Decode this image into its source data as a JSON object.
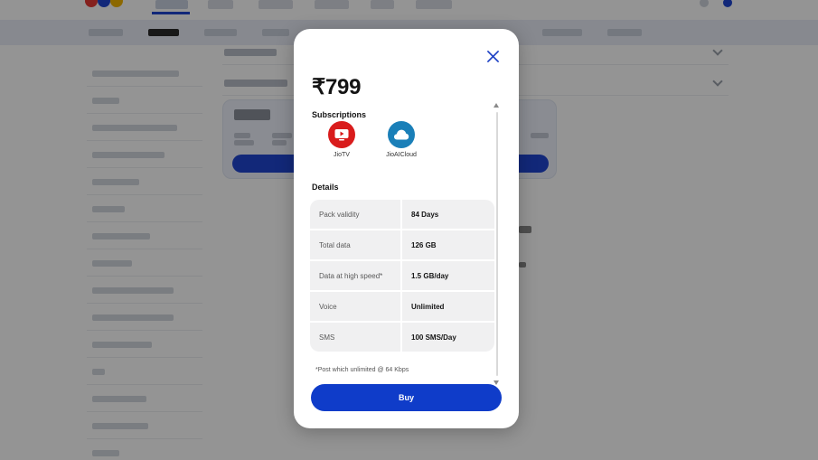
{
  "modal": {
    "price": "₹799",
    "subscriptions_title": "Subscriptions",
    "subscriptions": [
      {
        "label": "JioTV",
        "icon": "jiotv-icon",
        "color": "#d91c1c"
      },
      {
        "label": "JioAICloud",
        "icon": "jioaicloud-icon",
        "color": "#1a7fb8"
      }
    ],
    "details_title": "Details",
    "details": [
      {
        "key": "Pack validity",
        "value": "84 Days"
      },
      {
        "key": "Total data",
        "value": "126 GB"
      },
      {
        "key": "Data at high speed*",
        "value": "1.5 GB/day"
      },
      {
        "key": "Voice",
        "value": "Unlimited"
      },
      {
        "key": "SMS",
        "value": "100 SMS/Day"
      }
    ],
    "footnote": "*Post which unlimited @ 64 Kbps",
    "buy_label": "Buy"
  },
  "colors": {
    "accent": "#0f3cc9",
    "overlay": "rgba(0,0,0,0.42)",
    "jiotv": "#d91c1c",
    "jioaicloud": "#1a7fb8"
  }
}
